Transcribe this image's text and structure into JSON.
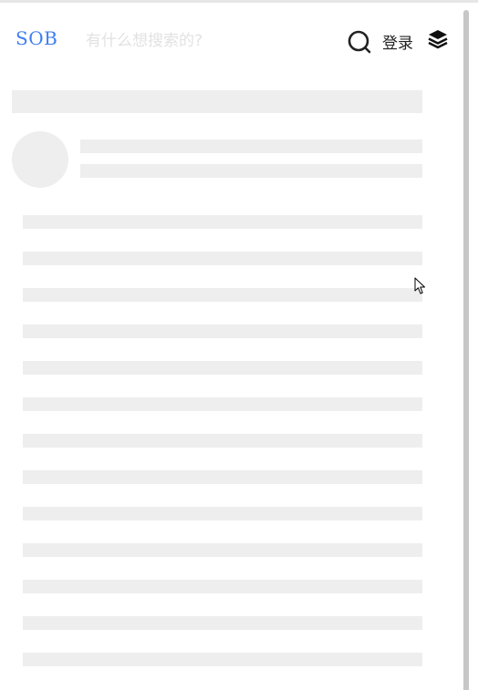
{
  "header": {
    "logo": "SOB",
    "search_placeholder": "有什么想搜索的?",
    "login_label": "登录",
    "search_icon": "search-icon",
    "menu_icon": "layers-icon"
  },
  "colors": {
    "logo": "#3f7ff0",
    "skeleton": "#eeeeee",
    "placeholder": "#e2e2e2"
  },
  "content": {
    "state": "loading-skeleton",
    "skeleton_line_count": 13
  }
}
